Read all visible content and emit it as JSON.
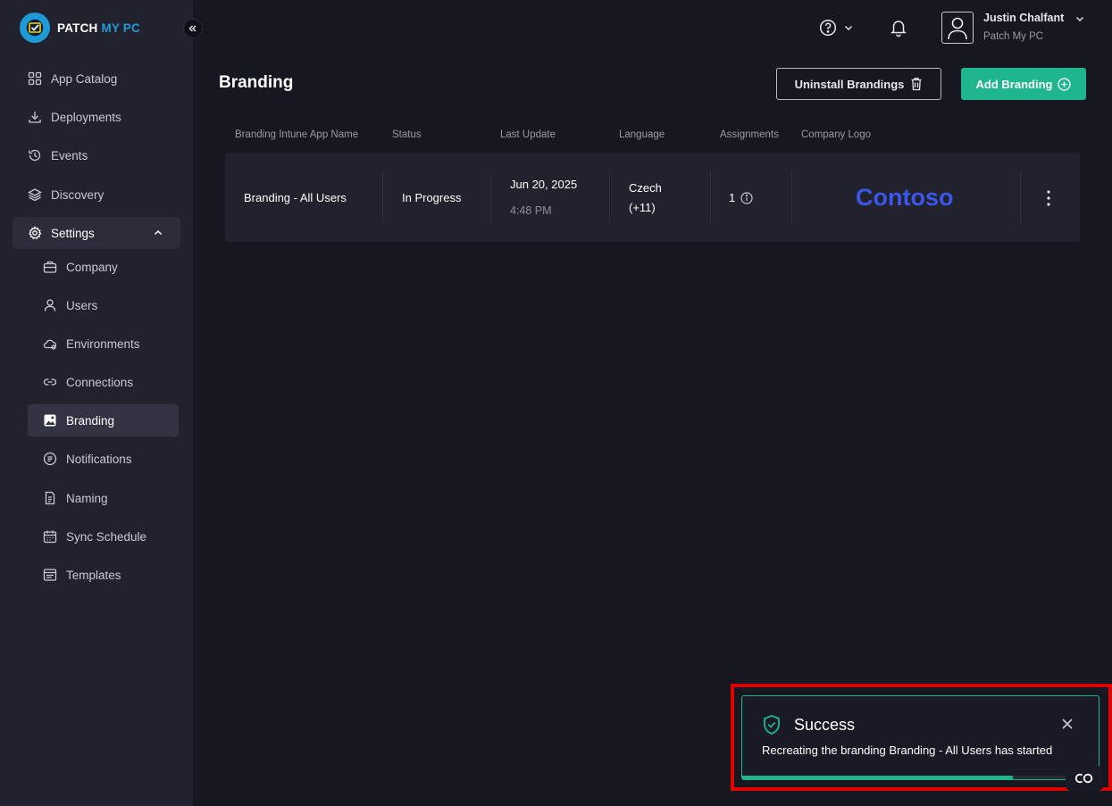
{
  "brand": {
    "name_part1": "PATCH",
    "name_part2": "MY PC"
  },
  "colors": {
    "accent": "#1fb58f",
    "brand_blue": "#1e9bd7",
    "logo_blue": "#3b57e8",
    "highlight": "#e00000"
  },
  "sidebar": {
    "items": [
      {
        "label": "App Catalog",
        "icon": "grid-icon"
      },
      {
        "label": "Deployments",
        "icon": "download-icon"
      },
      {
        "label": "Events",
        "icon": "history-icon"
      },
      {
        "label": "Discovery",
        "icon": "layers-icon"
      },
      {
        "label": "Settings",
        "icon": "gear-icon",
        "expanded": true
      }
    ],
    "sub_items": [
      {
        "label": "Company",
        "icon": "briefcase-icon"
      },
      {
        "label": "Users",
        "icon": "user-icon"
      },
      {
        "label": "Environments",
        "icon": "cloud-icon"
      },
      {
        "label": "Connections",
        "icon": "link-icon"
      },
      {
        "label": "Branding",
        "icon": "image-icon",
        "active": true
      },
      {
        "label": "Notifications",
        "icon": "notification-icon"
      },
      {
        "label": "Naming",
        "icon": "file-icon"
      },
      {
        "label": "Sync Schedule",
        "icon": "calendar-icon"
      },
      {
        "label": "Templates",
        "icon": "template-icon"
      }
    ]
  },
  "user": {
    "name": "Justin Chalfant",
    "org": "Patch My PC"
  },
  "page": {
    "title": "Branding"
  },
  "buttons": {
    "uninstall": "Uninstall Brandings",
    "add": "Add Branding"
  },
  "table": {
    "columns": [
      "Branding Intune App Name",
      "Status",
      "Last Update",
      "Language",
      "Assignments",
      "Company Logo"
    ],
    "rows": [
      {
        "name": "Branding - All Users",
        "status": "In Progress",
        "date": "Jun 20, 2025",
        "time": "4:48 PM",
        "language": "Czech",
        "language_more": "(+11)",
        "assignments": "1",
        "logo_text": "Contoso"
      }
    ]
  },
  "toast": {
    "title": "Success",
    "message": "Recreating the branding Branding - All Users has started",
    "progress": 0.76
  }
}
